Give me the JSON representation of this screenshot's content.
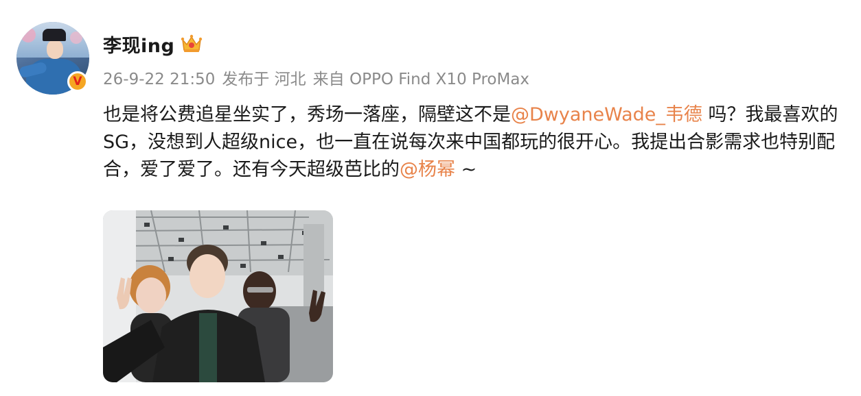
{
  "post": {
    "username": "李现ing",
    "meta": {
      "date": "26-9-22 21:50",
      "location": "发布于 河北",
      "device": "来自 OPPO Find X10 ProMax"
    },
    "content": {
      "part1": "也是将公费追星坐实了，秀场一落座，隔壁这不是",
      "mention1": "@DwyaneWade_韦德",
      "part2": " 吗？我最喜欢的SG，没想到人超级nice，也一直在说每次来中国都玩的很开心。我提出合影需求也特别配合，爱了爱了。还有今天超级芭比的",
      "mention2": "@杨幂",
      "part3": " ~"
    },
    "colors": {
      "mention": "#e8834a",
      "meta": "#8a8a8a",
      "verified_badge": "#f5a623"
    },
    "icons": {
      "crown": "crown-icon",
      "verified": "verified-v-icon"
    },
    "badge_letter": "V"
  }
}
